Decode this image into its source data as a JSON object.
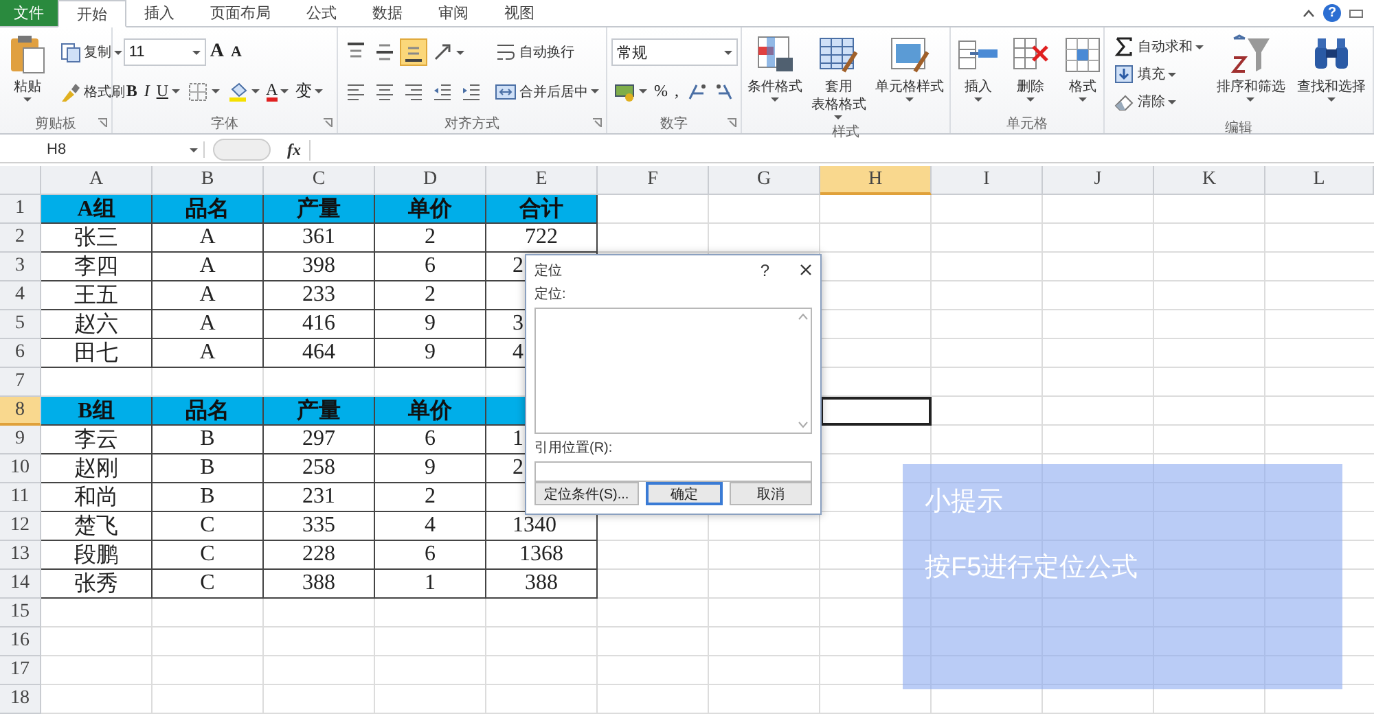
{
  "tabs": [
    {
      "label": "文件",
      "kind": "file",
      "selected": false
    },
    {
      "label": "开始",
      "kind": "tab",
      "selected": true
    },
    {
      "label": "插入",
      "kind": "tab",
      "selected": false
    },
    {
      "label": "页面布局",
      "kind": "tab",
      "selected": false
    },
    {
      "label": "公式",
      "kind": "tab",
      "selected": false
    },
    {
      "label": "数据",
      "kind": "tab",
      "selected": false
    },
    {
      "label": "审阅",
      "kind": "tab",
      "selected": false
    },
    {
      "label": "视图",
      "kind": "tab",
      "selected": false
    }
  ],
  "window_controls": {
    "help": "?"
  },
  "ribbon": [
    {
      "label": "剪贴板",
      "texts": [
        "粘贴",
        "复制",
        "格式刷"
      ]
    },
    {
      "label": "字体",
      "texts": [
        "11",
        "A",
        "A",
        "B",
        "I",
        "U",
        "A",
        "变"
      ]
    },
    {
      "label": "对齐方式",
      "texts": [
        "自动换行",
        "合并后居中"
      ],
      "vertical_align": [
        {
          "selected": false
        },
        {
          "selected": false
        },
        {
          "selected": true
        }
      ]
    },
    {
      "label": "数字",
      "texts": [
        "常规",
        "%",
        ","
      ]
    },
    {
      "label": "样式",
      "texts": [
        "条件格式",
        "套用",
        "表格格式",
        "单元格样式"
      ]
    },
    {
      "label": "单元格",
      "texts": [
        "插入",
        "删除",
        "格式"
      ]
    },
    {
      "label": "编辑",
      "texts": [
        "自动求和",
        "填充",
        "清除",
        "排序和筛选",
        "查找和选择"
      ]
    }
  ],
  "formula_bar": {
    "name_box": "H8",
    "fx": "fx"
  },
  "sheet": {
    "columns": [
      {
        "label": "A",
        "selected": false
      },
      {
        "label": "B",
        "selected": false
      },
      {
        "label": "C",
        "selected": false
      },
      {
        "label": "D",
        "selected": false
      },
      {
        "label": "E",
        "selected": false
      },
      {
        "label": "F",
        "selected": false
      },
      {
        "label": "G",
        "selected": false
      },
      {
        "label": "H",
        "selected": true
      },
      {
        "label": "I",
        "selected": false
      },
      {
        "label": "J",
        "selected": false
      },
      {
        "label": "K",
        "selected": false
      },
      {
        "label": "L",
        "selected": false
      }
    ],
    "rows": [
      {
        "header": "1",
        "selected": false,
        "kind": "header",
        "cells": [
          "A组",
          "品名",
          "产量",
          "单价",
          "合计"
        ]
      },
      {
        "header": "2",
        "selected": false,
        "kind": "data",
        "cells": [
          "张三",
          "A",
          "361",
          "2",
          "722"
        ]
      },
      {
        "header": "3",
        "selected": false,
        "kind": "data",
        "cells": [
          "李四",
          "A",
          "398",
          "6",
          "2"
        ]
      },
      {
        "header": "4",
        "selected": false,
        "kind": "data",
        "cells": [
          "王五",
          "A",
          "233",
          "2"
        ]
      },
      {
        "header": "5",
        "selected": false,
        "kind": "data",
        "cells": [
          "赵六",
          "A",
          "416",
          "9",
          "3"
        ]
      },
      {
        "header": "6",
        "selected": false,
        "kind": "data",
        "cells": [
          "田七",
          "A",
          "464",
          "9",
          "4"
        ]
      },
      {
        "header": "7",
        "selected": false,
        "kind": "blank",
        "cells": []
      },
      {
        "header": "8",
        "selected": true,
        "kind": "header",
        "cells": [
          "B组",
          "品名",
          "产量",
          "单价"
        ]
      },
      {
        "header": "9",
        "selected": false,
        "kind": "data",
        "cells": [
          "李云",
          "B",
          "297",
          "6",
          "1"
        ]
      },
      {
        "header": "10",
        "selected": false,
        "kind": "data",
        "cells": [
          "赵刚",
          "B",
          "258",
          "9",
          "2"
        ]
      },
      {
        "header": "11",
        "selected": false,
        "kind": "data",
        "cells": [
          "和尚",
          "B",
          "231",
          "2"
        ]
      },
      {
        "header": "12",
        "selected": false,
        "kind": "data",
        "cells": [
          "楚飞",
          "C",
          "335",
          "4",
          "1340"
        ]
      },
      {
        "header": "13",
        "selected": false,
        "kind": "data",
        "cells": [
          "段鹏",
          "C",
          "228",
          "6",
          "1368"
        ]
      },
      {
        "header": "14",
        "selected": false,
        "kind": "data",
        "cells": [
          "张秀",
          "C",
          "388",
          "1",
          "388"
        ]
      },
      {
        "header": "15",
        "selected": false,
        "kind": "blank",
        "cells": []
      },
      {
        "header": "16",
        "selected": false,
        "kind": "blank",
        "cells": []
      },
      {
        "header": "17",
        "selected": false,
        "kind": "blank",
        "cells": []
      },
      {
        "header": "18",
        "selected": false,
        "kind": "blank",
        "cells": []
      }
    ]
  },
  "dialog": {
    "title": "定位",
    "help": "?",
    "list_label": "定位:",
    "reference_label": "引用位置(R):",
    "buttons": [
      {
        "label": "定位条件(S)...",
        "default": false
      },
      {
        "label": "确定",
        "default": true
      },
      {
        "label": "取消",
        "default": false
      }
    ]
  },
  "tip": {
    "title": "小提示",
    "text": "按F5进行定位公式"
  }
}
